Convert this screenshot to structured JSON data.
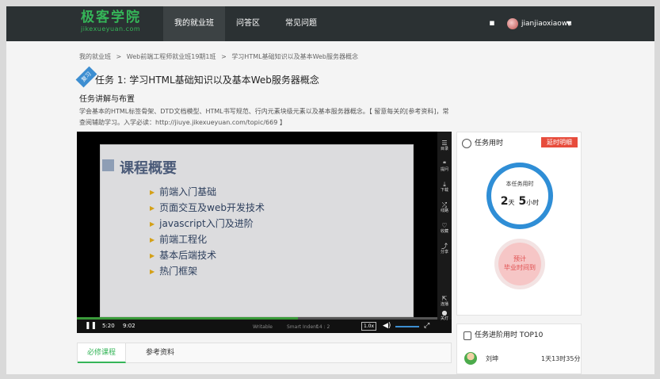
{
  "header": {
    "logo_cn": "极客学院",
    "logo_en": "jikexueyuan.com",
    "nav": [
      {
        "label": "我的就业班",
        "active": true
      },
      {
        "label": "问答区",
        "active": false
      },
      {
        "label": "常见问题",
        "active": false
      }
    ],
    "username": "jianjiaoxiaowu"
  },
  "breadcrumb": [
    "我的就业班",
    ">",
    "Web前端工程师就业班19期1班",
    ">",
    "学习HTML基础知识以及基本Web服务器概念"
  ],
  "task": {
    "ribbon": "复习",
    "title": "任务 1: 学习HTML基础知识以及基本Web服务器概念",
    "section_title": "任务讲解与布置",
    "description": "学会基本的HTML标签骨架、DTD文档模型、HTML书写规范、行内元素块级元素以及基本服务器概念。【 留意每关的[参考资料]，常查阅辅助学习。入学必读：http://jiuye.jikexueyuan.com/topic/669 】"
  },
  "player": {
    "slide_title": "课程概要",
    "slide_items": [
      "前端入门基础",
      "页面交互及web开发技术",
      "javascript入门及进阶",
      "前端工程化",
      "基本后端技术",
      "热门框架"
    ],
    "current_time": "5:20",
    "total_time": "9:02",
    "progress": 0.59,
    "watermark": [
      "Writable",
      "Smart Indent",
      "14 : 2"
    ],
    "speed": "1.0x",
    "tools": [
      {
        "icon": "☰",
        "label": "目录"
      },
      {
        "icon": "❝",
        "label": "提问"
      },
      {
        "icon": "⤓",
        "label": "下载"
      },
      {
        "icon": "⤮",
        "label": "线路"
      },
      {
        "icon": "♡",
        "label": "收藏"
      },
      {
        "icon": "⤴",
        "label": "分享"
      },
      {
        "icon": "⇱",
        "label": "连播"
      },
      {
        "icon": "●",
        "label": "关灯"
      }
    ]
  },
  "tabs": [
    {
      "label": "必修课程",
      "active": true
    },
    {
      "label": "参考资料",
      "active": false
    }
  ],
  "task_time": {
    "title": "任务用时",
    "delay_button": "延时明细",
    "ring_label": "本任务用时",
    "days": "2",
    "days_unit": "天",
    "hours": "5",
    "hours_unit": "小时",
    "predict_line1": "预计",
    "predict_line2": "毕业时间到"
  },
  "ranking": {
    "title": "任务进阶用时 TOP10",
    "entries": [
      {
        "name": "刘坤",
        "time": "1天13时35分"
      }
    ]
  }
}
